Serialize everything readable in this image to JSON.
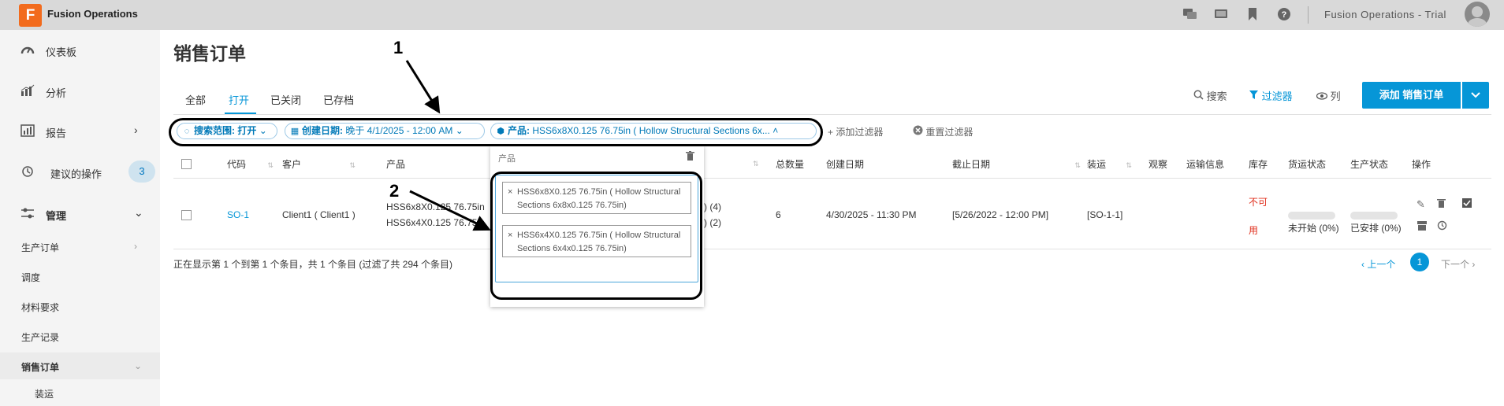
{
  "header": {
    "logo_letter": "F",
    "app_title": "Fusion Operations",
    "trial_label": "Fusion Operations - Trial",
    "icons": [
      "chat-icon",
      "monitor-icon",
      "bookmark-icon",
      "help-icon"
    ]
  },
  "sidebar": {
    "items": [
      {
        "label": "仪表板",
        "icon": "dashboard-icon"
      },
      {
        "label": "分析",
        "icon": "analytics-icon"
      },
      {
        "label": "报告",
        "icon": "report-icon"
      },
      {
        "label": "建议的操作",
        "icon": "history-icon",
        "badge": "3"
      },
      {
        "label": "管理",
        "icon": "settings-sliders-icon"
      }
    ],
    "sub_items": [
      "生产订单",
      "调度",
      "材料要求",
      "生产记录",
      "销售订单",
      "装运"
    ]
  },
  "page": {
    "title": "销售订单",
    "tabs": [
      "全部",
      "打开",
      "已关闭",
      "已存档"
    ],
    "active_tab": "打开",
    "toolbar": {
      "search": "搜索",
      "filter": "过滤器",
      "columns": "列",
      "add_button": "添加 销售订单"
    }
  },
  "filters": {
    "scope_label": "搜索范围:",
    "scope_value": "打开",
    "date_label": "创建日期:",
    "date_value": "晚于 4/1/2025 - 12:00 AM",
    "product_label": "产品:",
    "product_value": "HSS6x8X0.125 76.75in ( Hollow Structural Sections 6x...",
    "add_filter": "添加过滤器",
    "reset_filter": "重置过滤器"
  },
  "table": {
    "headers": [
      "代码",
      "客户",
      "产品",
      "总数量",
      "创建日期",
      "截止日期",
      "装运",
      "观察",
      "运输信息",
      "库存",
      "货运状态",
      "生产状态",
      "操作"
    ],
    "row": {
      "code": "SO-1",
      "customer": "Client1 ( Client1 )",
      "product_1": "HSS6x8X0.125 76.75in",
      "product_2": "HSS6x4X0.125 76.75in",
      "qty_1": ") (4)",
      "qty_2": ") (2)",
      "total_qty": "6",
      "created": "4/30/2025 - 11:30 PM",
      "due": "[5/26/2022 - 12:00 PM]",
      "shipment": "[SO-1-1]",
      "stock_1": "不可",
      "stock_2": "用",
      "shipping_status": "未开始 (0%)",
      "production_status": "已安排 (0%)"
    },
    "summary": "正在显示第 1 个到第 1 个条目，共 1 个条目 (过滤了共 294 个条目)",
    "pager": {
      "prev": "上一个",
      "page": "1",
      "next": "下一个"
    }
  },
  "dropdown": {
    "label": "产品",
    "tags": [
      {
        "line1": "HSS6x8X0.125 76.75in ( Hollow Structural",
        "line2": "Sections 6x8x0.125 76.75in)"
      },
      {
        "line1": "HSS6x4X0.125 76.75in ( Hollow Structural",
        "line2": "Sections 6x4x0.125 76.75in)"
      }
    ]
  },
  "annotations": {
    "one": "1",
    "two": "2"
  },
  "colors": {
    "accent": "#0696d7",
    "brand": "#f26b1d",
    "warning": "#e0301e"
  }
}
